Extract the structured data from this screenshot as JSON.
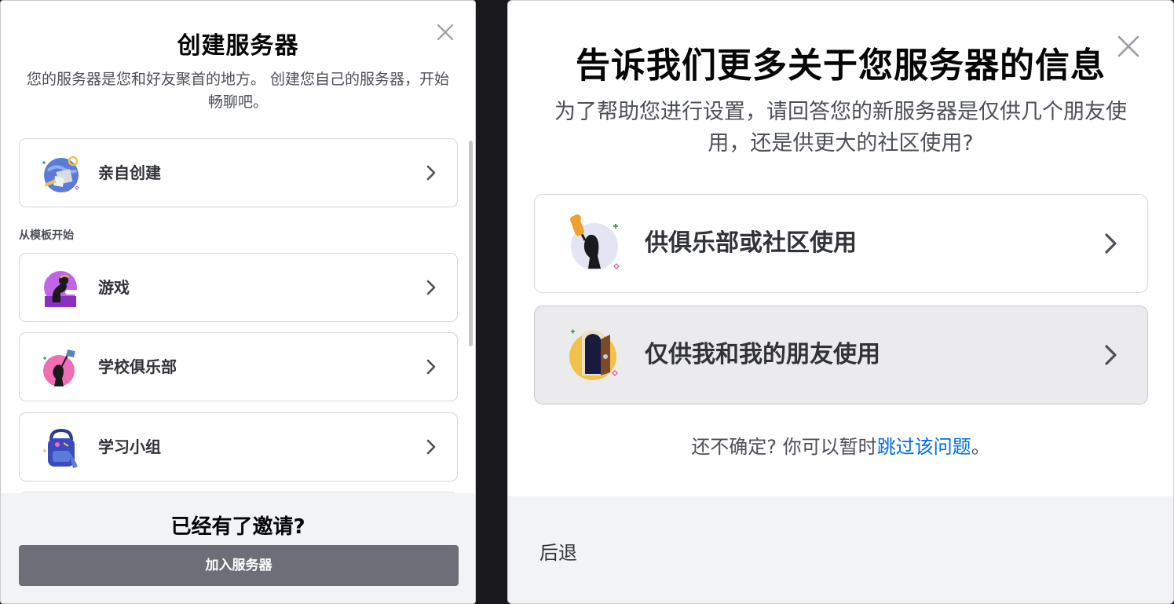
{
  "left": {
    "title": "创建服务器",
    "subtitle": "您的服务器是您和好友聚首的地方。 创建您自己的服务器，开始畅聊吧。",
    "create_own": {
      "label": "亲自创建",
      "icon": "globe-build-icon"
    },
    "section_label": "从模板开始",
    "templates": [
      {
        "label": "游戏",
        "icon": "gaming-icon"
      },
      {
        "label": "学校俱乐部",
        "icon": "school-club-icon"
      },
      {
        "label": "学习小组",
        "icon": "study-group-icon"
      }
    ],
    "footer_title": "已经有了邀请?",
    "join_button": "加入服务器"
  },
  "right": {
    "title": "告诉我们更多关于您服务器的信息",
    "subtitle": "为了帮助您进行设置，请回答您的新服务器是仅供几个朋友使用，还是供更大的社区使用?",
    "options": [
      {
        "label": "供俱乐部或社区使用",
        "icon": "club-community-icon"
      },
      {
        "label": "仅供我和我的朋友使用",
        "icon": "friends-door-icon"
      }
    ],
    "unsure_prefix": "还不确定? 你可以暂时",
    "skip_link": "跳过该问题",
    "unsure_suffix": "。",
    "back_button": "后退"
  },
  "colors": {
    "link": "#006ce7",
    "join_button_bg": "#6d6f78",
    "footer_bg": "#f2f3f5",
    "hover_option_bg": "#ebebed"
  }
}
